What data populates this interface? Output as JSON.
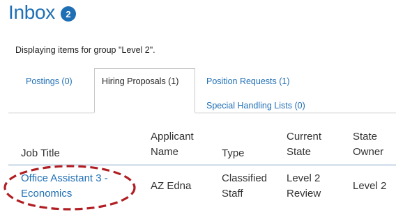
{
  "header": {
    "title": "Inbox",
    "badge_count": "2"
  },
  "group_message": "Displaying items for group \"Level 2\".",
  "tabs": [
    {
      "label": "Postings (0)",
      "active": false
    },
    {
      "label": "Hiring Proposals (1)",
      "active": true
    },
    {
      "label": "Position Requests (1)",
      "active": false
    },
    {
      "label": "Special Handling Lists (0)",
      "active": false
    }
  ],
  "table": {
    "columns": [
      {
        "line1": "Job Title",
        "line2": ""
      },
      {
        "line1": "Applicant",
        "line2": "Name"
      },
      {
        "line1": "Type",
        "line2": ""
      },
      {
        "line1": "Current",
        "line2": "State"
      },
      {
        "line1": "State",
        "line2": "Owner"
      }
    ],
    "rows": [
      {
        "job_title_line1": "Office Assistant 3 -",
        "job_title_line2": "Economics",
        "applicant_name": "AZ Edna",
        "type_line1": "Classified",
        "type_line2": "Staff",
        "current_state_line1": "Level 2",
        "current_state_line2": "Review",
        "state_owner": "Level 2"
      }
    ]
  },
  "colors": {
    "accent": "#1f6fb5",
    "annotation": "#b01e23"
  }
}
